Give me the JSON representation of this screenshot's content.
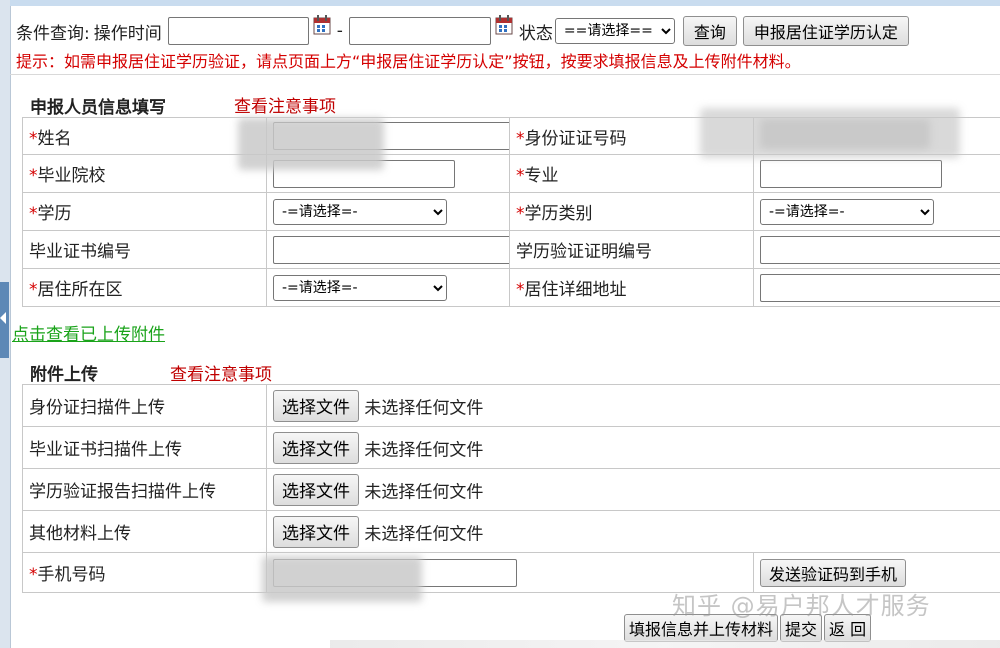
{
  "query": {
    "label": "条件查询:",
    "time_label": "操作时间",
    "dash": "-",
    "status_label": "状态",
    "status_value": "==请选择==",
    "search_button": "查询",
    "apply_button": "申报居住证学历认定"
  },
  "tip": "提示：如需申报居住证学历验证，请点页面上方“申报居住证学历认定”按钮，按要求填报信息及上传附件材料。",
  "person_section": {
    "title": "申报人员信息填写",
    "notes_link": "查看注意事项",
    "required_mark": "*",
    "fields": {
      "name": "姓名",
      "id_number": "身份证证号码",
      "school": "毕业院校",
      "major": "专业",
      "education": "学历",
      "education_type": "学历类别",
      "certificate_no": "毕业证书编号",
      "verification_no": "学历验证证明编号",
      "district": "居住所在区",
      "address": "居住详细地址"
    },
    "select_placeholder": "-=请选择=-"
  },
  "uploaded_link": "点击查看已上传附件",
  "attachment_section": {
    "title": "附件上传",
    "notes_link": "查看注意事项",
    "choose_file": "选择文件",
    "no_file": "未选择任何文件",
    "items": [
      "身份证扫描件上传",
      "毕业证书扫描件上传",
      "学历验证报告扫描件上传",
      "其他材料上传"
    ],
    "phone_label": "手机号码",
    "send_code_button": "发送验证码到手机"
  },
  "actions": {
    "submit_upload": "填报信息并上传材料",
    "submit": "提交",
    "back": "返 回"
  },
  "watermark": "知乎 @易户邦人才服务",
  "colors": {
    "required": "#d40000",
    "link_red": "#c00000",
    "link_green": "#1aa31a",
    "tip": "#d40000"
  }
}
